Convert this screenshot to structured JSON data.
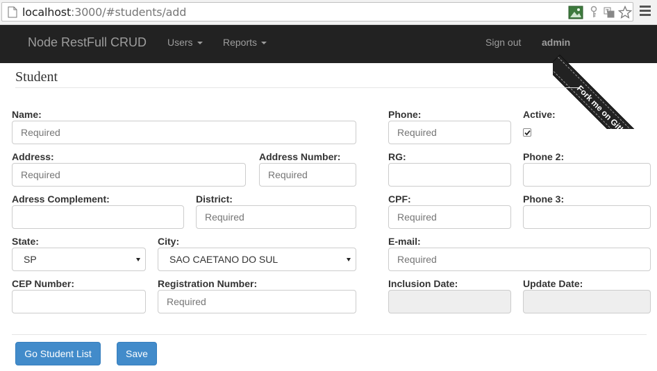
{
  "browser": {
    "url_host": "localhost",
    "url_path": ":3000/#students/add"
  },
  "navbar": {
    "brand": "Node RestFull CRUD",
    "users_menu": "Users",
    "reports_menu": "Reports",
    "sign_out": "Sign out",
    "user": "admin",
    "ribbon": "Fork me on GitHub"
  },
  "page": {
    "title": "Student"
  },
  "form": {
    "name": {
      "label": "Name:",
      "placeholder": "Required",
      "value": ""
    },
    "address": {
      "label": "Address:",
      "placeholder": "Required",
      "value": ""
    },
    "address_number": {
      "label": "Address Number:",
      "placeholder": "Required",
      "value": ""
    },
    "address_complement": {
      "label": "Adress Complement:",
      "placeholder": "",
      "value": ""
    },
    "district": {
      "label": "District:",
      "placeholder": "Required",
      "value": ""
    },
    "state": {
      "label": "State:",
      "value": "SP"
    },
    "city": {
      "label": "City:",
      "value": "SAO CAETANO DO SUL"
    },
    "cep": {
      "label": "CEP Number:",
      "placeholder": "",
      "value": ""
    },
    "registration_number": {
      "label": "Registration Number:",
      "placeholder": "Required",
      "value": ""
    },
    "phone": {
      "label": "Phone:",
      "placeholder": "Required",
      "value": ""
    },
    "active": {
      "label": "Active:",
      "checked": true
    },
    "rg": {
      "label": "RG:",
      "placeholder": "",
      "value": ""
    },
    "phone2": {
      "label": "Phone 2:",
      "placeholder": "",
      "value": ""
    },
    "cpf": {
      "label": "CPF:",
      "placeholder": "Required",
      "value": ""
    },
    "phone3": {
      "label": "Phone 3:",
      "placeholder": "",
      "value": ""
    },
    "email": {
      "label": "E-mail:",
      "placeholder": "Required",
      "value": ""
    },
    "inclusion_date": {
      "label": "Inclusion Date:",
      "value": ""
    },
    "update_date": {
      "label": "Update Date:",
      "value": ""
    }
  },
  "buttons": {
    "go_list": "Go Student List",
    "save": "Save"
  },
  "colors": {
    "navbar_bg": "#222222",
    "primary_button": "#428bca",
    "disabled_field": "#eeeeee"
  }
}
